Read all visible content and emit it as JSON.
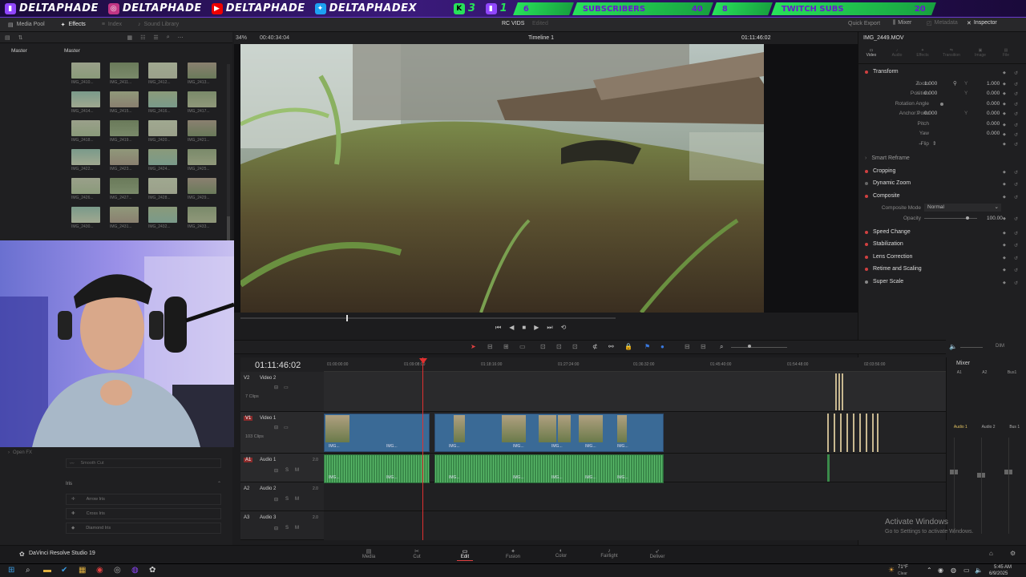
{
  "banner": {
    "handle": "DELTAPHADE",
    "handle_x": "DELTAPHADEX",
    "kick_count": "3",
    "twitch_count": "1",
    "stat1": "6",
    "subscribers_label": "SUBSCRIBERS",
    "stat2": "40",
    "stat3": "8",
    "twitch_subs_label": "TWITCH SUBS",
    "stat4": "20"
  },
  "header": {
    "app": "DaVinci",
    "media_pool": "Media Pool",
    "effects": "Effects",
    "index": "Index",
    "sound_library": "Sound Library",
    "project": "RC VIDS",
    "edited": "Edited",
    "quick_export": "Quick Export",
    "mixer": "Mixer",
    "metadata": "Metadata",
    "inspector": "Inspector"
  },
  "viewer_bar": {
    "zoom": "34%",
    "timecode_left": "00:40:34:04",
    "timeline_name": "Timeline 1",
    "timecode_right": "01:11:46:02"
  },
  "media": {
    "master_left": "Master",
    "master_right": "Master",
    "clips": [
      "IMG_2410...",
      "IMG_2411...",
      "IMG_2412...",
      "IMG_2413...",
      "IMG_2414...",
      "IMG_2415...",
      "IMG_2416...",
      "IMG_2417...",
      "IMG_2418...",
      "IMG_2419...",
      "IMG_2420...",
      "IMG_2421...",
      "IMG_2422...",
      "IMG_2423...",
      "IMG_2424...",
      "IMG_2425...",
      "IMG_2426...",
      "IMG_2427...",
      "IMG_2428...",
      "IMG_2429...",
      "IMG_2430...",
      "IMG_2431...",
      "IMG_2432...",
      "IMG_2433..."
    ]
  },
  "effects": {
    "open_fx": "Open FX",
    "smooth_cut": "Smooth Cut",
    "iris_section": "Iris",
    "iris_items": [
      "Arrow Iris",
      "Cross Iris",
      "Diamond Iris"
    ]
  },
  "inspector": {
    "clip_name": "IMG_2449.MOV",
    "tabs": [
      "Video",
      "Audio",
      "Effects",
      "Transition",
      "Image",
      "File"
    ],
    "transform": "Transform",
    "zoom_label": "Zoom",
    "zoom_x": "1.000",
    "zoom_y": "1.000",
    "position_label": "Position",
    "position_x": "0.000",
    "position_y": "0.000",
    "rotation_label": "Rotation Angle",
    "rotation_value": "0.000",
    "anchor_label": "Anchor Point",
    "anchor_x": "0.000",
    "anchor_y": "0.000",
    "pitch_label": "Pitch",
    "pitch_value": "0.000",
    "yaw_label": "Yaw",
    "yaw_value": "0.000",
    "flip_label": "Flip",
    "smart_reframe": "Smart Reframe",
    "cropping": "Cropping",
    "dynamic_zoom": "Dynamic Zoom",
    "composite": "Composite",
    "composite_mode_label": "Composite Mode",
    "composite_mode_value": "Normal",
    "opacity_label": "Opacity",
    "opacity_value": "100.00",
    "speed_change": "Speed Change",
    "stabilization": "Stabilization",
    "lens_correction": "Lens Correction",
    "retime": "Retime and Scaling",
    "super_scale": "Super Scale"
  },
  "timeline": {
    "timecode": "01:11:46:02",
    "ruler": [
      "01:00:00:00",
      "01:09:08:00",
      "01:18:16:00",
      "01:27:24:00",
      "01:36:32:00",
      "01:45:40:00",
      "01:54:48:00",
      "02:03:56:00"
    ],
    "tracks": [
      {
        "id": "V2",
        "name": "Video 2",
        "info": "7 Clips"
      },
      {
        "id": "V1",
        "name": "Video 1",
        "info": "103 Clips"
      },
      {
        "id": "A1",
        "name": "Audio 1",
        "info": "2.0"
      },
      {
        "id": "A2",
        "name": "Audio 2",
        "info": "2.0"
      },
      {
        "id": "A3",
        "name": "Audio 3",
        "info": "2.0"
      }
    ],
    "clip_label": "IMG..."
  },
  "mixer": {
    "title": "Mixer",
    "channels": [
      "A1",
      "A2",
      "Bus1"
    ],
    "bottom_channels": [
      "Audio 1",
      "Audio 2",
      "Bus 1"
    ]
  },
  "pages": [
    "Media",
    "Cut",
    "Edit",
    "Fusion",
    "Color",
    "Fairlight",
    "Deliver"
  ],
  "active_page": "Edit",
  "app_footer": "DaVinci Resolve Studio 19",
  "activate": {
    "title": "Activate Windows",
    "subtitle": "Go to Settings to activate Windows."
  },
  "taskbar": {
    "weather": "71°F",
    "weather_sub": "Clear",
    "time": "5:45 AM",
    "date": "6/9/2025"
  },
  "colors": {
    "banner_bg": "#2a0f5a",
    "banner_stat": "#28e05a",
    "video_clip": "#3a6a96",
    "audio_clip": "#3a8a4a",
    "playhead": "#e03030",
    "accent_red": "#d04040"
  }
}
